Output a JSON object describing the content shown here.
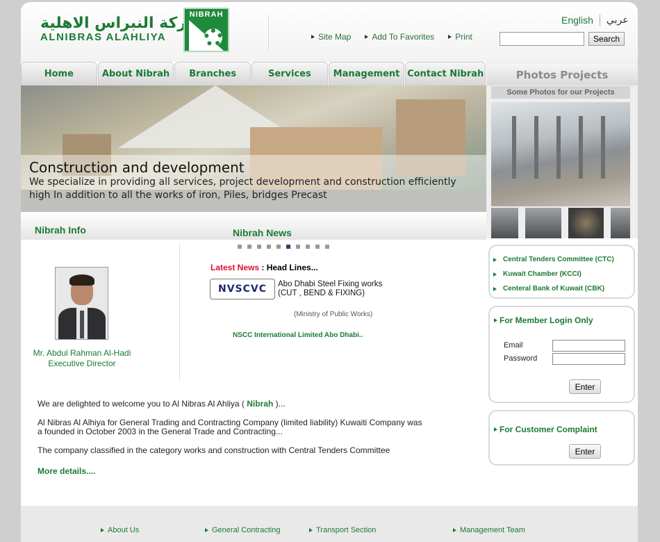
{
  "header": {
    "logo_arabic": "شركة النبراس الاهلية",
    "logo_english": "ALNIBRAS  ALAHLIYA",
    "logo_badge": "NIBRAH",
    "top_links": [
      "Site Map",
      "Add To Favorites",
      "Print"
    ],
    "lang_english": "English",
    "lang_arabic": "عربي",
    "search_button": "Search"
  },
  "nav": {
    "tabs": [
      "Home",
      "About Nibrah",
      "Branches",
      "Services",
      "Management",
      "Contact Nibrah"
    ]
  },
  "hero": {
    "title": "Construction and development",
    "text": "We specialize in providing all services, project development and construction efficiently high In addition to all the works of iron, Piles, bridges Precast"
  },
  "photos": {
    "title": "Photos Projects",
    "subtitle": "Some Photos for our Projects"
  },
  "info": {
    "title": "Nibrah Info",
    "person_name": "Mr. Abdul Rahman Al-Hadi",
    "person_role": "Executive Director"
  },
  "news": {
    "title": "Nibrah News",
    "latest_label": "Latest News",
    "headlines_label": " : Head Lines...",
    "logo_text": "NVSCVC",
    "item_title_line1": "Abo Dhabi Steel Fixing works",
    "item_title_line2": "(CUT , BEND & FIXING)",
    "item_source": "(Ministry of Public Works)",
    "item_company": "NSCC International Limited Abo Dhabi.."
  },
  "welcome": {
    "line1_pre": "We are delighted to welcome you to Al Nibras Al Ahliya ( ",
    "line1_bold": "Nibrah",
    "line1_post": " )...",
    "para2": "Al Nibras Al Alhiya for General Trading and Contracting Company (limited liability) Kuwaiti Company was a founded in October 2003 in the General Trade and Contracting...",
    "para3": "The company classified in the category works and construction with Central Tenders Committee",
    "more": "More details...."
  },
  "sidebar_links": [
    "Central Tenders Committee (CTC)",
    "Kuwait Chamber (KCCI)",
    "Centeral Bank of Kuwait (CBK)"
  ],
  "login": {
    "title": "For Member Login Only",
    "email_label": "Email",
    "password_label": "Password",
    "enter_button": "Enter"
  },
  "complaint": {
    "title": "For Customer Complaint",
    "enter_button": "Enter"
  },
  "footer": {
    "links": [
      "About Us",
      "General Contracting",
      "Transport Section",
      "Management Team"
    ]
  },
  "colors": {
    "brand_green": "#1b7a35",
    "latest_red": "#e0102e",
    "page_bg": "#cfcfcf"
  }
}
